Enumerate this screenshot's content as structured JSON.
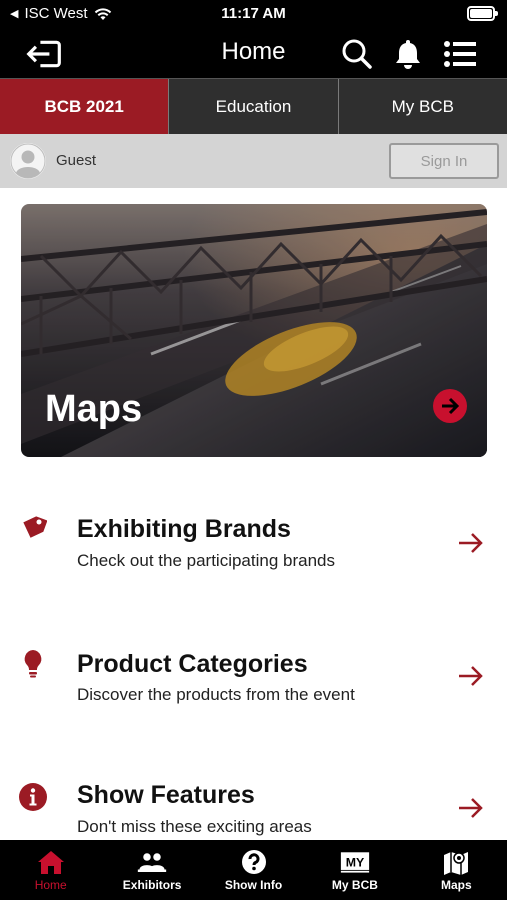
{
  "status_bar": {
    "carrier": "ISC West",
    "time": "11:17 AM"
  },
  "nav": {
    "title": "Home",
    "icons": [
      "logout-icon",
      "search-icon",
      "bell-icon",
      "menu-list-icon"
    ]
  },
  "tabs": [
    {
      "label": "BCB 2021",
      "active": true
    },
    {
      "label": "Education",
      "active": false
    },
    {
      "label": "My BCB",
      "active": false
    }
  ],
  "guest": {
    "label": "Guest",
    "sign_in_label": "Sign In"
  },
  "hero": {
    "title": "Maps"
  },
  "list": [
    {
      "title": "Exhibiting Brands",
      "subtitle": "Check out the participating brands",
      "icon": "tag-icon"
    },
    {
      "title": "Product Categories",
      "subtitle": "Discover the products from the event",
      "icon": "lightbulb-icon"
    },
    {
      "title": "Show Features",
      "subtitle": "Don't miss these exciting areas",
      "icon": "info-icon"
    }
  ],
  "tabbar": [
    {
      "label": "Home",
      "icon": "home-icon",
      "active": true
    },
    {
      "label": "Exhibitors",
      "icon": "exhibitors-icon",
      "active": false
    },
    {
      "label": "Show Info",
      "icon": "question-icon",
      "active": false
    },
    {
      "label": "My BCB",
      "icon": "my-icon",
      "active": false
    },
    {
      "label": "Maps",
      "icon": "map-icon",
      "active": false
    }
  ],
  "colors": {
    "accent": "#9b1b24",
    "tabbar_active": "#c8102e"
  }
}
